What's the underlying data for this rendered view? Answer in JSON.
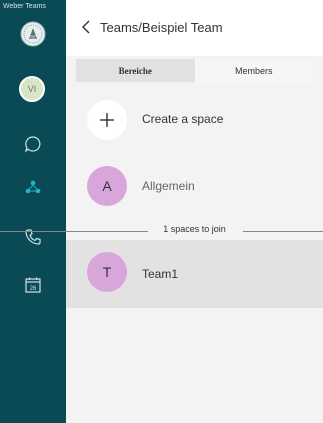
{
  "sidebar": {
    "app_title": "Weber Teams",
    "user_avatar": "VI",
    "calendar_day": "26",
    "icons": [
      "seal-logo",
      "chat-icon",
      "teams-icon",
      "phone-icon",
      "calendar-icon"
    ]
  },
  "header": {
    "breadcrumb": "Teams/Beispiel Team"
  },
  "tabs": [
    {
      "label": "Bereiche",
      "active": true
    },
    {
      "label": "Members",
      "active": false
    }
  ],
  "spaces": {
    "create_label": "Create a space",
    "items": [
      {
        "initial": "A",
        "name": "Allgemein"
      }
    ]
  },
  "divider": {
    "label": "1 spaces to join"
  },
  "joinable": [
    {
      "initial": "T",
      "name": "Team1"
    }
  ],
  "colors": {
    "sidebar": "#0a4a55",
    "accent": "#1fb8c8",
    "avatar": "#d9a6dc",
    "selected_row": "#e2e2e2"
  }
}
